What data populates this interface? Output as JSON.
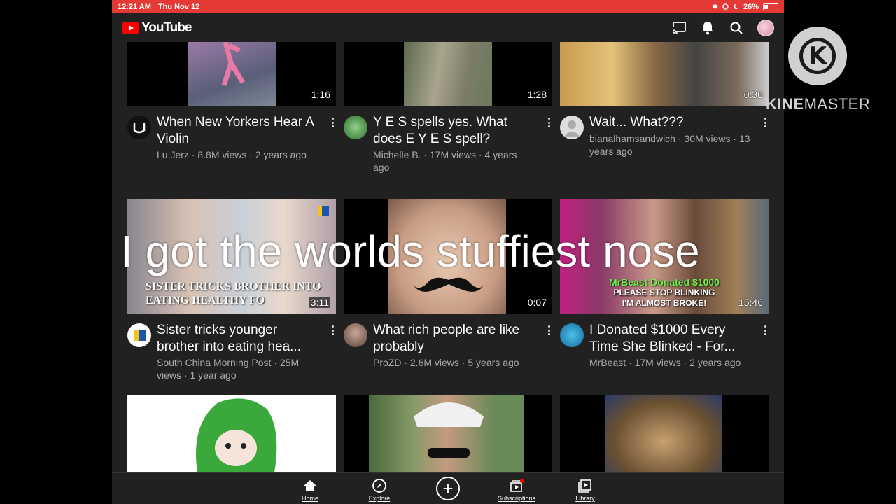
{
  "status_bar": {
    "time": "12:21 AM",
    "date": "Thu Nov 12",
    "battery": "26%",
    "battery_level": 0.26
  },
  "app": {
    "title": "YouTube",
    "brand_color": "#ff0000",
    "icons": [
      "cast-icon",
      "bell-icon",
      "search-icon",
      "account-avatar"
    ]
  },
  "videos": [
    {
      "title": "When New Yorkers Hear A Violin",
      "channel": "Lu Jerz",
      "meta": "Lu Jerz · 8.8M views · 2 years ago",
      "duration": "1:16"
    },
    {
      "title": "Y E S spells yes. What does E Y E S spell?",
      "channel": "Michelle B.",
      "meta": "Michelle B. · 17M views · 4 years ago",
      "duration": "1:28"
    },
    {
      "title": "Wait... What???",
      "channel": "bianalhamsandwich",
      "meta": "bianalhamsandwich · 30M views · 13 years ago",
      "duration": "0:36"
    },
    {
      "title": "Sister tricks younger brother into eating hea...",
      "channel": "South China Morning Post",
      "meta": "South China Morning Post · 25M views · 1 year ago",
      "duration": "3:11",
      "thumb_text": "SISTER TRICKS BROTHER INTO EATING HEALTHY FO"
    },
    {
      "title": "What rich people are like probably",
      "channel": "ProZD",
      "meta": "ProZD · 2.6M views · 5 years ago",
      "duration": "0:07"
    },
    {
      "title": "I Donated $1000 Every Time She Blinked - For...",
      "channel": "MrBeast",
      "meta": "MrBeast · 17M views · 2 years ago",
      "duration": "15:46",
      "thumb_text_1": "MrBeast Donated $1000",
      "thumb_text_2": "PLEASE STOP BLINKING",
      "thumb_text_3": "I'M ALMOST BROKE!"
    }
  ],
  "overlay_caption": "I got the worlds stuffiest nose",
  "bottom_nav": {
    "home": "Home",
    "explore": "Explore",
    "add": "+",
    "subscriptions": "Subscriptions",
    "library": "Library"
  },
  "watermark": {
    "letter": "K",
    "text_bold": "KINE",
    "text_light": "MASTER"
  }
}
